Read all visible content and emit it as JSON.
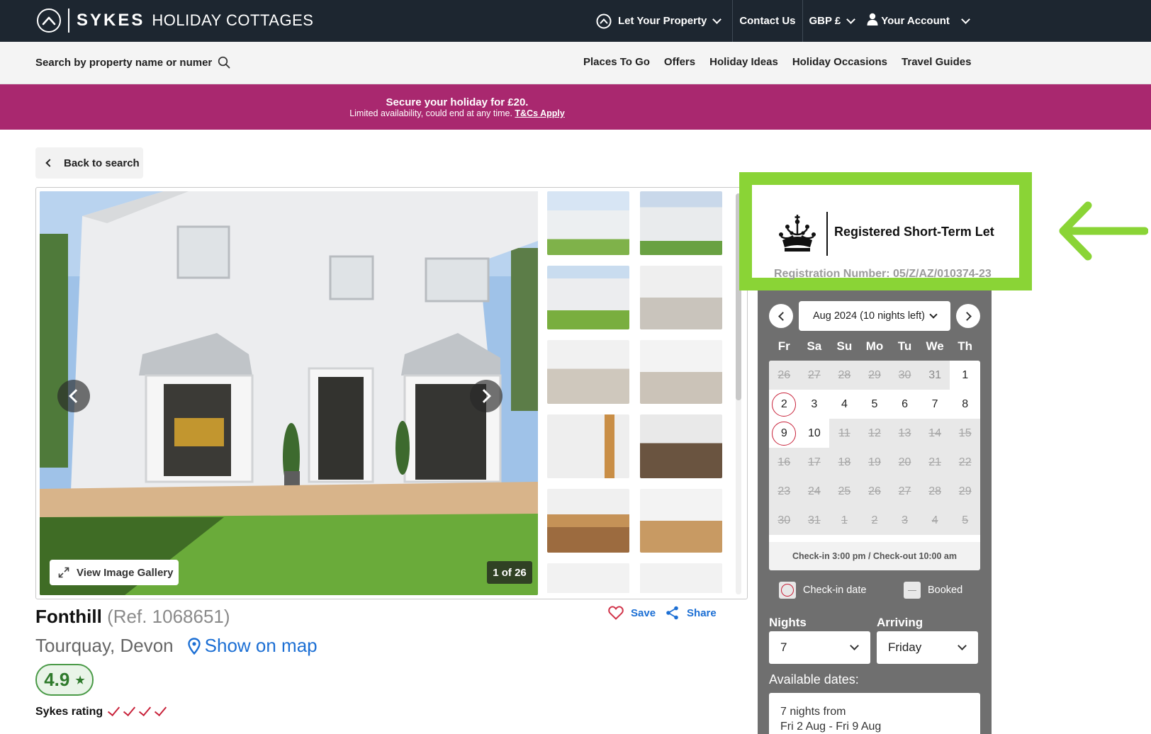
{
  "header": {
    "brand_bold": "SYKES",
    "brand_rest": "HOLIDAY COTTAGES",
    "let_property": "Let Your Property",
    "contact": "Contact Us",
    "currency": "GBP £",
    "account": "Your Account"
  },
  "subnav": {
    "search_placeholder": "Search by property name or numer",
    "links": [
      "Places To Go",
      "Offers",
      "Holiday Ideas",
      "Holiday Occasions",
      "Travel Guides"
    ]
  },
  "promo": {
    "title": "Secure your holiday for £20.",
    "subtitle": "Limited availability, could end at any time.",
    "link": "T&Cs Apply",
    "color": "#a9286f"
  },
  "back_label": "Back to search",
  "gallery": {
    "view_label": "View Image Gallery",
    "counter": "1 of 26"
  },
  "property": {
    "name": "Fonthill",
    "ref": "(Ref. 1068651)",
    "location": "Tourquay, Devon",
    "map_label": "Show on map",
    "save_label": "Save",
    "share_label": "Share",
    "rating": "4.9",
    "sykes_rating_label": "Sykes rating",
    "sykes_rating_ticks": 4
  },
  "registration": {
    "title": "Registered Short-Term Let",
    "number": "Registration Number: 05/Z/AZ/010374-23",
    "highlight_color": "#8ad436"
  },
  "booking": {
    "month": "Aug 2024 (10 nights left)",
    "weekdays": [
      "Fr",
      "Sa",
      "Su",
      "Mo",
      "Tu",
      "We",
      "Th"
    ],
    "weeks": [
      [
        {
          "d": "26",
          "s": "booked"
        },
        {
          "d": "27",
          "s": "booked"
        },
        {
          "d": "28",
          "s": "booked"
        },
        {
          "d": "29",
          "s": "booked"
        },
        {
          "d": "30",
          "s": "booked"
        },
        {
          "d": "31",
          "s": "past"
        },
        {
          "d": "1",
          "s": "free"
        }
      ],
      [
        {
          "d": "2",
          "s": "checkin"
        },
        {
          "d": "3",
          "s": "free"
        },
        {
          "d": "4",
          "s": "free"
        },
        {
          "d": "5",
          "s": "free"
        },
        {
          "d": "6",
          "s": "free"
        },
        {
          "d": "7",
          "s": "free"
        },
        {
          "d": "8",
          "s": "free"
        }
      ],
      [
        {
          "d": "9",
          "s": "checkin"
        },
        {
          "d": "10",
          "s": "free"
        },
        {
          "d": "11",
          "s": "booked"
        },
        {
          "d": "12",
          "s": "booked"
        },
        {
          "d": "13",
          "s": "booked"
        },
        {
          "d": "14",
          "s": "booked"
        },
        {
          "d": "15",
          "s": "booked"
        }
      ],
      [
        {
          "d": "16",
          "s": "booked"
        },
        {
          "d": "17",
          "s": "booked"
        },
        {
          "d": "18",
          "s": "booked"
        },
        {
          "d": "19",
          "s": "booked"
        },
        {
          "d": "20",
          "s": "booked"
        },
        {
          "d": "21",
          "s": "booked"
        },
        {
          "d": "22",
          "s": "booked"
        }
      ],
      [
        {
          "d": "23",
          "s": "booked"
        },
        {
          "d": "24",
          "s": "booked"
        },
        {
          "d": "25",
          "s": "booked"
        },
        {
          "d": "26",
          "s": "booked"
        },
        {
          "d": "27",
          "s": "booked"
        },
        {
          "d": "28",
          "s": "booked"
        },
        {
          "d": "29",
          "s": "booked"
        }
      ],
      [
        {
          "d": "30",
          "s": "booked"
        },
        {
          "d": "31",
          "s": "booked"
        },
        {
          "d": "1",
          "s": "booked"
        },
        {
          "d": "2",
          "s": "booked"
        },
        {
          "d": "3",
          "s": "booked"
        },
        {
          "d": "4",
          "s": "booked"
        },
        {
          "d": "5",
          "s": "booked"
        }
      ]
    ],
    "check_times": "Check-in 3:00 pm / Check-out 10:00 am",
    "legend_checkin": "Check-in date",
    "legend_booked": "Booked",
    "nights_label": "Nights",
    "nights_value": "7",
    "arriving_label": "Arriving",
    "arriving_value": "Friday",
    "available_label": "Available dates:",
    "available_line1": "7 nights from",
    "available_line2": "Fri 2 Aug - Fri 9 Aug"
  }
}
